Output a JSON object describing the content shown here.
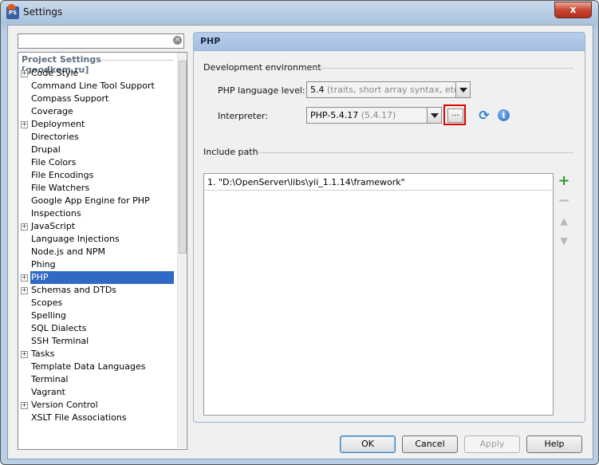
{
  "window": {
    "title": "Settings",
    "close_label": "x"
  },
  "search": {
    "value": "",
    "clear_icon": "clear-icon"
  },
  "tree": {
    "header": "Project Settings [goodkom.ru]",
    "items": [
      {
        "label": "Code Style",
        "expandable": true,
        "selected": false
      },
      {
        "label": "Command Line Tool Support",
        "expandable": false,
        "selected": false
      },
      {
        "label": "Compass Support",
        "expandable": false,
        "selected": false
      },
      {
        "label": "Coverage",
        "expandable": false,
        "selected": false
      },
      {
        "label": "Deployment",
        "expandable": true,
        "selected": false
      },
      {
        "label": "Directories",
        "expandable": false,
        "selected": false
      },
      {
        "label": "Drupal",
        "expandable": false,
        "selected": false
      },
      {
        "label": "File Colors",
        "expandable": false,
        "selected": false
      },
      {
        "label": "File Encodings",
        "expandable": false,
        "selected": false
      },
      {
        "label": "File Watchers",
        "expandable": false,
        "selected": false
      },
      {
        "label": "Google App Engine for PHP",
        "expandable": false,
        "selected": false
      },
      {
        "label": "Inspections",
        "expandable": false,
        "selected": false
      },
      {
        "label": "JavaScript",
        "expandable": true,
        "selected": false
      },
      {
        "label": "Language Injections",
        "expandable": false,
        "selected": false
      },
      {
        "label": "Node.js and NPM",
        "expandable": false,
        "selected": false
      },
      {
        "label": "Phing",
        "expandable": false,
        "selected": false
      },
      {
        "label": "PHP",
        "expandable": true,
        "selected": true
      },
      {
        "label": "Schemas and DTDs",
        "expandable": true,
        "selected": false
      },
      {
        "label": "Scopes",
        "expandable": false,
        "selected": false
      },
      {
        "label": "Spelling",
        "expandable": false,
        "selected": false
      },
      {
        "label": "SQL Dialects",
        "expandable": false,
        "selected": false
      },
      {
        "label": "SSH Terminal",
        "expandable": false,
        "selected": false
      },
      {
        "label": "Tasks",
        "expandable": true,
        "selected": false
      },
      {
        "label": "Template Data Languages",
        "expandable": false,
        "selected": false
      },
      {
        "label": "Terminal",
        "expandable": false,
        "selected": false
      },
      {
        "label": "Vagrant",
        "expandable": false,
        "selected": false
      },
      {
        "label": "Version Control",
        "expandable": true,
        "selected": false
      },
      {
        "label": "XSLT File Associations",
        "expandable": false,
        "selected": false
      }
    ]
  },
  "panel": {
    "title": "PHP",
    "dev_env_title": "Development environment",
    "php_level_label": "PHP language level:",
    "php_level_value": "5.4",
    "php_level_desc": " (traits, short array syntax, etc.)",
    "interpreter_label": "Interpreter:",
    "interpreter_value": "PHP-5.4.17",
    "interpreter_version": " (5.4.17)",
    "browse_label": "...",
    "include_title": "Include path",
    "include_paths": [
      "1. \"D:\\OpenServer\\libs\\yii_1.1.14\\framework\""
    ],
    "add_icon": "plus-icon",
    "remove_icon": "minus-icon",
    "move_up_icon": "arrow-up-icon",
    "move_down_icon": "arrow-down-icon"
  },
  "buttons": {
    "ok": "OK",
    "cancel": "Cancel",
    "apply": "Apply",
    "help": "Help"
  },
  "colors": {
    "selection": "#3169c6",
    "highlight_border": "#e20000",
    "add_icon": "#2e9b2e"
  }
}
